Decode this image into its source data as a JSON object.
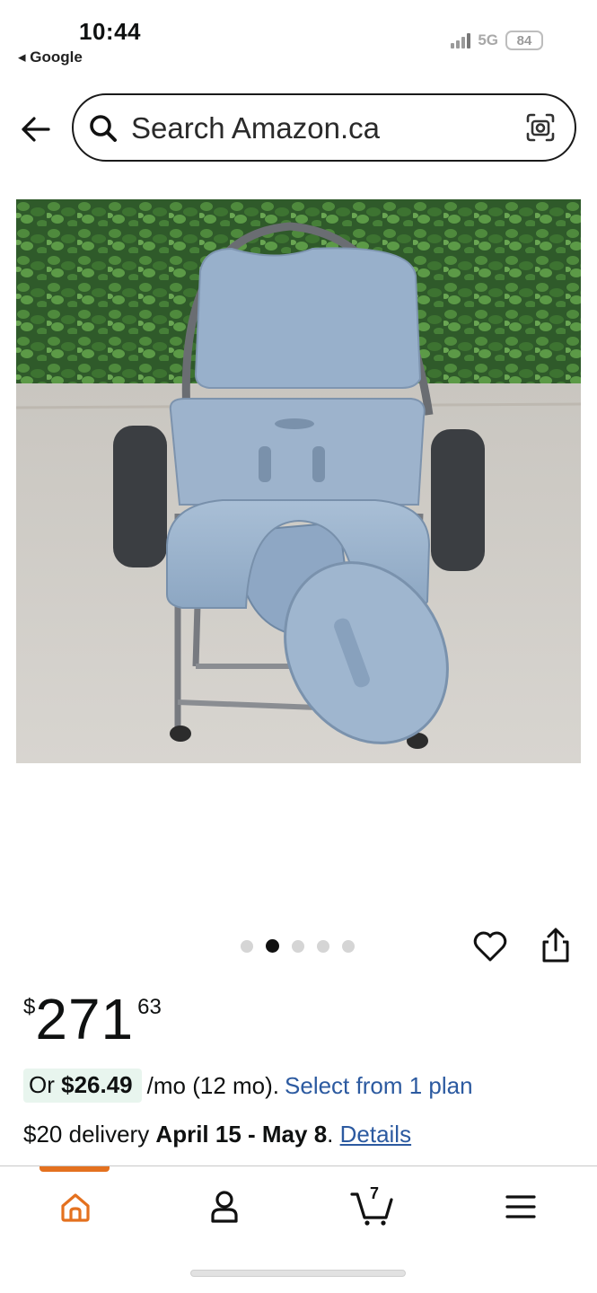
{
  "status_bar": {
    "time": "10:44",
    "back_app": "◂ Google",
    "network": "5G",
    "battery": "84"
  },
  "search": {
    "placeholder": "Search Amazon.ca"
  },
  "icons": {
    "back": "back-arrow-icon",
    "search": "search-icon",
    "camera": "camera-icon",
    "heart": "heart-icon",
    "share": "share-icon",
    "home": "home-icon",
    "account": "account-icon",
    "cart": "cart-icon",
    "menu": "menu-icon"
  },
  "carousel": {
    "dot_count": 5,
    "active_index": 1
  },
  "price": {
    "symbol": "$",
    "whole": "271",
    "fraction": "63"
  },
  "financing": {
    "prefix": "Or ",
    "amount": "$26.49",
    "terms": "/mo (12 mo).",
    "link": "Select from 1 plan"
  },
  "delivery": {
    "prefix": "$20 delivery ",
    "dates": "April 15 - May 8",
    "suffix": ". ",
    "link": "Details"
  },
  "bottom_nav": {
    "cart_count": "7",
    "active_tab": "home"
  },
  "colors": {
    "accent_orange": "#e4711f",
    "link_blue": "#2c5aa0",
    "plan_highlight": "#e8f5ee"
  }
}
